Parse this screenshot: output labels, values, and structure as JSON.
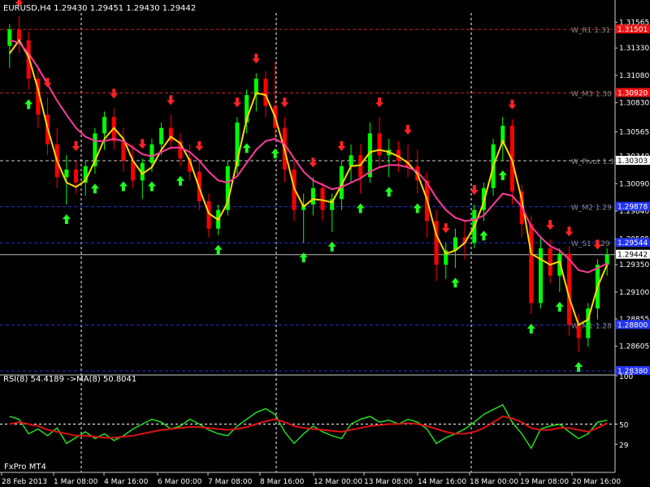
{
  "header": {
    "symbol_info": "EURUSD,H4  1.29430 1.29451 1.29430 1.29442"
  },
  "broker_label": "FxPro MT4",
  "chart_data": [
    {
      "type": "candlestick",
      "symbol": "EURUSD",
      "timeframe": "H4",
      "ohlc": {
        "open": 1.2943,
        "high": 1.29451,
        "low": 1.2943,
        "close": 1.29442
      },
      "ylim": [
        1.2835,
        1.3165
      ],
      "y_ticks": [
        "1.31565",
        "1.31330",
        "1.31080",
        "1.30830",
        "1.30565",
        "1.30340",
        "1.30090",
        "1.29840",
        "1.29585",
        "1.29350",
        "1.29100",
        "1.28855",
        "1.28605"
      ],
      "x_ticks": [
        "28 Feb 2013",
        "1 Mar 08:00",
        "4 Mar 16:00",
        "6 Mar 00:00",
        "7 Mar 08:00",
        "8 Mar 16:00",
        "12 Mar 00:00",
        "13 Mar 08:00",
        "14 Mar 16:00",
        "18 Mar 00:00",
        "19 Mar 08:00",
        "20 Mar 16:00"
      ],
      "current_price": "1.29442",
      "level_lines": [
        {
          "name": "W_R1",
          "label": "W_R1 1.31",
          "value": 1.315,
          "price_tag": "1.31501",
          "color": "#cc2222"
        },
        {
          "name": "W_M3",
          "label": "W_M3 1.30",
          "value": 1.3092,
          "price_tag": "1.30920",
          "color": "#cc2222"
        },
        {
          "name": "W_Pivot",
          "label": "W_Pivot 1.3",
          "value": 1.303,
          "price_tag": "1.30303",
          "color": "#cccccc"
        },
        {
          "name": "W_M2",
          "label": "W_M2 1.29",
          "value": 1.2988,
          "price_tag": "1.29878",
          "color": "#2233cc"
        },
        {
          "name": "W_S1",
          "label": "W_S1 1.29",
          "value": 1.2955,
          "price_tag": "1.29544",
          "color": "#2233cc"
        },
        {
          "name": "W_M1",
          "label": "W_M1 1.28",
          "value": 1.288,
          "price_tag": "1.28800",
          "color": "#2233cc"
        },
        {
          "name": "W_S2",
          "label": "",
          "value": 1.2838,
          "price_tag": "1.28380",
          "color": "#2233cc"
        }
      ],
      "candles": [
        [
          1.3135,
          1.3155,
          1.3115,
          1.315
        ],
        [
          1.315,
          1.3162,
          1.3128,
          1.314
        ],
        [
          1.314,
          1.3148,
          1.3095,
          1.3105
        ],
        [
          1.3105,
          1.3115,
          1.306,
          1.3072
        ],
        [
          1.3072,
          1.3088,
          1.3035,
          1.3045
        ],
        [
          1.3045,
          1.306,
          1.3005,
          1.3015
        ],
        [
          1.3015,
          1.3035,
          1.299,
          1.3022
        ],
        [
          1.3022,
          1.303,
          1.3,
          1.301
        ],
        [
          1.301,
          1.303,
          1.2998,
          1.3025
        ],
        [
          1.3025,
          1.306,
          1.3018,
          1.3055
        ],
        [
          1.3055,
          1.3075,
          1.304,
          1.307
        ],
        [
          1.307,
          1.3078,
          1.304,
          1.3048
        ],
        [
          1.3048,
          1.306,
          1.302,
          1.303
        ],
        [
          1.303,
          1.3045,
          1.3005,
          1.3012
        ],
        [
          1.3012,
          1.3032,
          1.2995,
          1.3028
        ],
        [
          1.3028,
          1.305,
          1.302,
          1.3045
        ],
        [
          1.3045,
          1.3065,
          1.3035,
          1.306
        ],
        [
          1.306,
          1.3072,
          1.304,
          1.3048
        ],
        [
          1.3048,
          1.3055,
          1.3025,
          1.3032
        ],
        [
          1.3032,
          1.3045,
          1.3012,
          1.302
        ],
        [
          1.302,
          1.303,
          1.2985,
          1.2993
        ],
        [
          1.2993,
          1.3,
          1.296,
          1.2968
        ],
        [
          1.2968,
          1.299,
          1.2962,
          1.2985
        ],
        [
          1.2985,
          1.303,
          1.298,
          1.3025
        ],
        [
          1.3025,
          1.307,
          1.3018,
          1.3065
        ],
        [
          1.3065,
          1.3095,
          1.3055,
          1.309
        ],
        [
          1.309,
          1.311,
          1.3075,
          1.3105
        ],
        [
          1.3105,
          1.3112,
          1.307,
          1.308
        ],
        [
          1.308,
          1.312,
          1.305,
          1.306
        ],
        [
          1.306,
          1.307,
          1.301,
          1.3022
        ],
        [
          1.3022,
          1.303,
          1.2975,
          1.2985
        ],
        [
          1.2985,
          1.3,
          1.2955,
          1.299
        ],
        [
          1.299,
          1.3015,
          1.298,
          1.3005
        ],
        [
          1.3005,
          1.301,
          1.2975,
          1.2985
        ],
        [
          1.2985,
          1.3,
          1.2965,
          1.2995
        ],
        [
          1.2995,
          1.303,
          1.2985,
          1.3025
        ],
        [
          1.3025,
          1.3045,
          1.301,
          1.3035
        ],
        [
          1.3035,
          1.3045,
          1.3,
          1.3015
        ],
        [
          1.3015,
          1.3065,
          1.301,
          1.3055
        ],
        [
          1.3055,
          1.307,
          1.3025,
          1.3035
        ],
        [
          1.3035,
          1.305,
          1.3015,
          1.304
        ],
        [
          1.304,
          1.3048,
          1.302,
          1.303
        ],
        [
          1.303,
          1.3045,
          1.3015,
          1.3025
        ],
        [
          1.3025,
          1.304,
          1.3,
          1.3012
        ],
        [
          1.3012,
          1.302,
          1.296,
          1.2975
        ],
        [
          1.2975,
          1.2985,
          1.292,
          1.2935
        ],
        [
          1.2935,
          1.2955,
          1.2922,
          1.2948
        ],
        [
          1.2948,
          1.2968,
          1.2932,
          1.296
        ],
        [
          1.296,
          1.2975,
          1.294,
          1.2955
        ],
        [
          1.2955,
          1.299,
          1.295,
          1.2985
        ],
        [
          1.2985,
          1.301,
          1.2975,
          1.3005
        ],
        [
          1.3005,
          1.305,
          1.2998,
          1.3045
        ],
        [
          1.3045,
          1.307,
          1.303,
          1.3062
        ],
        [
          1.3062,
          1.3068,
          1.299,
          1.3002
        ],
        [
          1.3002,
          1.3008,
          1.296,
          1.2972
        ],
        [
          1.2972,
          1.298,
          1.289,
          1.29
        ],
        [
          1.29,
          1.296,
          1.2895,
          1.295
        ],
        [
          1.295,
          1.2958,
          1.2918,
          1.2925
        ],
        [
          1.2925,
          1.295,
          1.291,
          1.2945
        ],
        [
          1.2945,
          1.2952,
          1.287,
          1.288
        ],
        [
          1.288,
          1.289,
          1.2855,
          1.2868
        ],
        [
          1.2868,
          1.29,
          1.286,
          1.2895
        ],
        [
          1.2895,
          1.294,
          1.2885,
          1.2935
        ],
        [
          1.2935,
          1.295,
          1.2925,
          1.2944
        ]
      ],
      "series": [
        {
          "name": "",
          "color": "#ffd700",
          "values": [
            1.3128,
            1.314,
            1.3125,
            1.3095,
            1.306,
            1.303,
            1.301,
            1.3006,
            1.3012,
            1.303,
            1.305,
            1.306,
            1.305,
            1.303,
            1.3018,
            1.3024,
            1.304,
            1.3052,
            1.3046,
            1.303,
            1.3005,
            1.2982,
            1.2976,
            1.2992,
            1.303,
            1.3068,
            1.3092,
            1.309,
            1.307,
            1.304,
            1.3005,
            1.2988,
            1.2995,
            1.2994,
            1.2992,
            1.3008,
            1.3025,
            1.3026,
            1.3038,
            1.304,
            1.3038,
            1.3034,
            1.3028,
            1.3018,
            1.2995,
            1.2962,
            1.2945,
            1.2948,
            1.2955,
            1.297,
            1.2992,
            1.3025,
            1.3048,
            1.303,
            1.2995,
            1.2945,
            1.294,
            1.2935,
            1.2938,
            1.2905,
            1.288,
            1.2885,
            1.2915,
            1.2935
          ]
        },
        {
          "name": "",
          "color": "#ff3a9c",
          "values": [
            1.314,
            1.3138,
            1.3128,
            1.3115,
            1.31,
            1.3085,
            1.3072,
            1.306,
            1.3052,
            1.3048,
            1.3048,
            1.305,
            1.3048,
            1.3042,
            1.3036,
            1.3034,
            1.3038,
            1.3042,
            1.3042,
            1.3038,
            1.303,
            1.302,
            1.3012,
            1.301,
            1.3016,
            1.3028,
            1.304,
            1.3048,
            1.305,
            1.3045,
            1.3032,
            1.302,
            1.3012,
            1.3008,
            1.3004,
            1.3006,
            1.301,
            1.3014,
            1.302,
            1.3024,
            1.3026,
            1.3026,
            1.3024,
            1.302,
            1.301,
            1.2996,
            1.2985,
            1.2978,
            1.2975,
            1.2976,
            1.298,
            1.299,
            1.3,
            1.2998,
            1.2988,
            1.297,
            1.296,
            1.2952,
            1.2948,
            1.294,
            1.293,
            1.2928,
            1.2932,
            1.2936
          ]
        }
      ],
      "signals": {
        "up_indices": [
          2,
          6,
          9,
          12,
          15,
          18,
          22,
          25,
          28,
          31,
          34,
          37,
          40,
          43,
          47,
          50,
          52,
          55,
          58,
          60
        ],
        "down_indices": [
          1,
          4,
          7,
          11,
          14,
          17,
          20,
          24,
          26,
          29,
          32,
          35,
          39,
          42,
          46,
          49,
          53,
          57,
          59,
          62
        ]
      }
    },
    {
      "type": "line",
      "indicator_label": "RSI(8) 54.4189  ->MA(8) 50.8041",
      "ylim": [
        0,
        100
      ],
      "y_ticks": [
        "100",
        "50",
        "29"
      ],
      "series": [
        {
          "name": "",
          "color": "#22dd22",
          "values": [
            58,
            55,
            40,
            45,
            38,
            46,
            30,
            36,
            42,
            35,
            40,
            33,
            38,
            45,
            50,
            55,
            52,
            45,
            48,
            55,
            50,
            44,
            40,
            38,
            48,
            55,
            62,
            66,
            60,
            42,
            30,
            40,
            48,
            42,
            38,
            35,
            50,
            55,
            58,
            52,
            54,
            50,
            55,
            52,
            45,
            30,
            36,
            40,
            45,
            52,
            60,
            65,
            70,
            52,
            40,
            25,
            45,
            48,
            50,
            42,
            35,
            40,
            52,
            54
          ]
        },
        {
          "name": "",
          "color": "#dd1111",
          "values": [
            50,
            52,
            50,
            48,
            44,
            42,
            40,
            38,
            38,
            37,
            36,
            36,
            37,
            38,
            40,
            42,
            44,
            45,
            46,
            47,
            47,
            46,
            45,
            44,
            45,
            47,
            50,
            53,
            55,
            52,
            48,
            46,
            45,
            44,
            43,
            42,
            44,
            46,
            48,
            49,
            50,
            50,
            51,
            50,
            48,
            45,
            42,
            40,
            40,
            42,
            46,
            52,
            58,
            56,
            52,
            46,
            44,
            44,
            46,
            46,
            44,
            42,
            46,
            51
          ]
        }
      ]
    }
  ]
}
